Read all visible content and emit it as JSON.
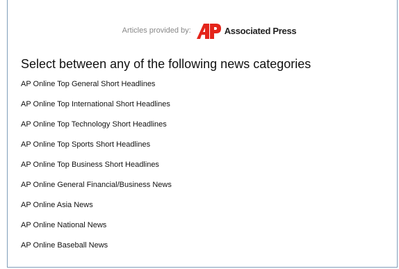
{
  "provider": {
    "label": "Articles provided by:",
    "logo_icon": "ap-logo-icon",
    "name": "Associated Press",
    "logo_color": "#e4251b"
  },
  "heading": "Select between any of the following news categories",
  "categories": [
    "AP Online Top General Short Headlines",
    "AP Online Top International Short Headlines",
    "AP Online Top Technology Short Headlines",
    "AP Online Top Sports Short Headlines",
    "AP Online Top Business Short Headlines",
    "AP Online General Financial/Business News",
    "AP Online Asia News",
    "AP Online National News",
    "AP Online Baseball News"
  ]
}
